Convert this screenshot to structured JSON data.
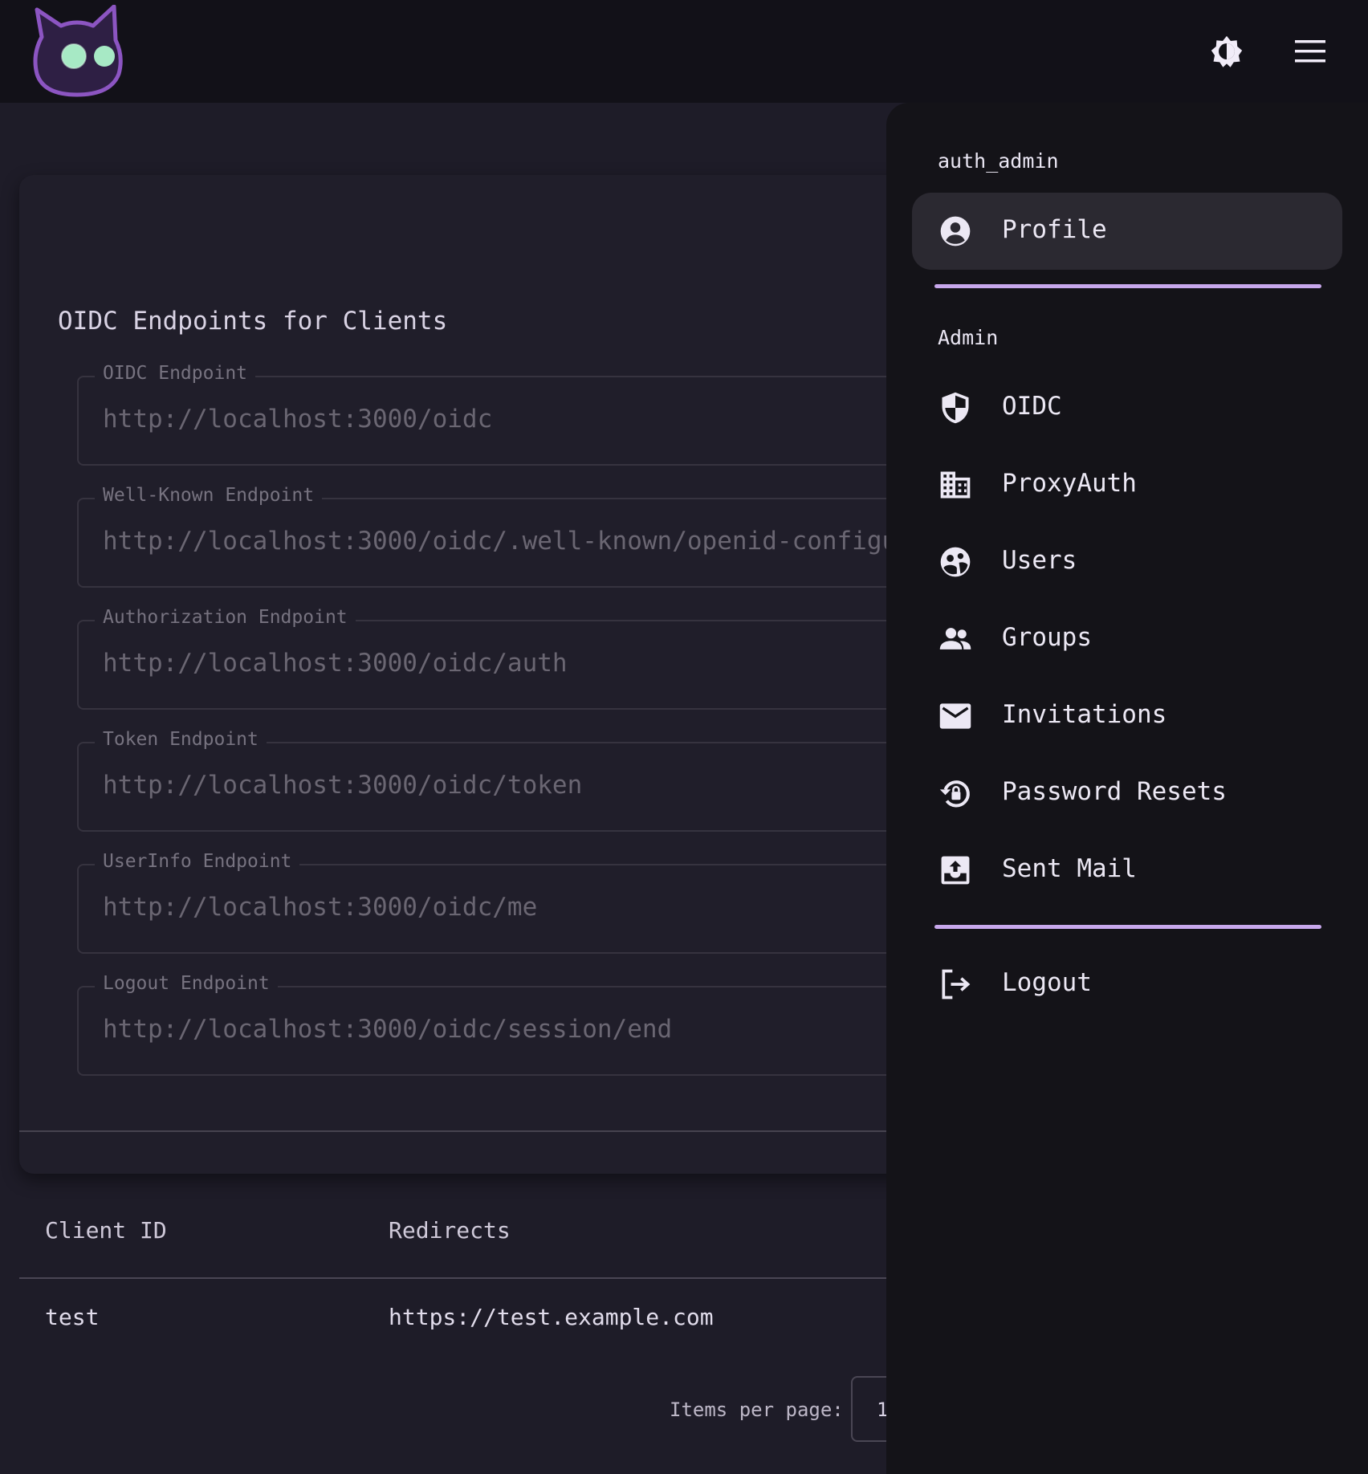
{
  "header": {
    "logo_icon": "cat-logo-icon",
    "theme_icon": "brightness-icon",
    "menu_icon": "hamburger-menu-icon"
  },
  "oidc_card": {
    "title": "OIDC Endpoints for Clients",
    "fields": [
      {
        "label": "OIDC Endpoint",
        "value": "http://localhost:3000/oidc"
      },
      {
        "label": "Well-Known Endpoint",
        "value": "http://localhost:3000/oidc/.well-known/openid-configur"
      },
      {
        "label": "Authorization Endpoint",
        "value": "http://localhost:3000/oidc/auth"
      },
      {
        "label": "Token Endpoint",
        "value": "http://localhost:3000/oidc/token"
      },
      {
        "label": "UserInfo Endpoint",
        "value": "http://localhost:3000/oidc/me"
      },
      {
        "label": "Logout Endpoint",
        "value": "http://localhost:3000/oidc/session/end"
      }
    ]
  },
  "clients_table": {
    "columns": [
      "Client ID",
      "Redirects"
    ],
    "rows": [
      {
        "client_id": "test",
        "redirects": "https://test.example.com"
      }
    ],
    "items_per_page_label": "Items per page:",
    "items_per_page_value": "1"
  },
  "drawer": {
    "username": "auth_admin",
    "profile_label": "Profile",
    "admin_heading": "Admin",
    "admin_items": [
      {
        "label": "OIDC",
        "icon": "shield-icon"
      },
      {
        "label": "ProxyAuth",
        "icon": "building-icon"
      },
      {
        "label": "Users",
        "icon": "account-cog-icon"
      },
      {
        "label": "Groups",
        "icon": "group-icon"
      },
      {
        "label": "Invitations",
        "icon": "mail-icon"
      },
      {
        "label": "Password Resets",
        "icon": "lock-reset-icon"
      },
      {
        "label": "Sent Mail",
        "icon": "outbox-icon"
      }
    ],
    "logout_label": "Logout",
    "accent_color": "#c8a8ec"
  }
}
